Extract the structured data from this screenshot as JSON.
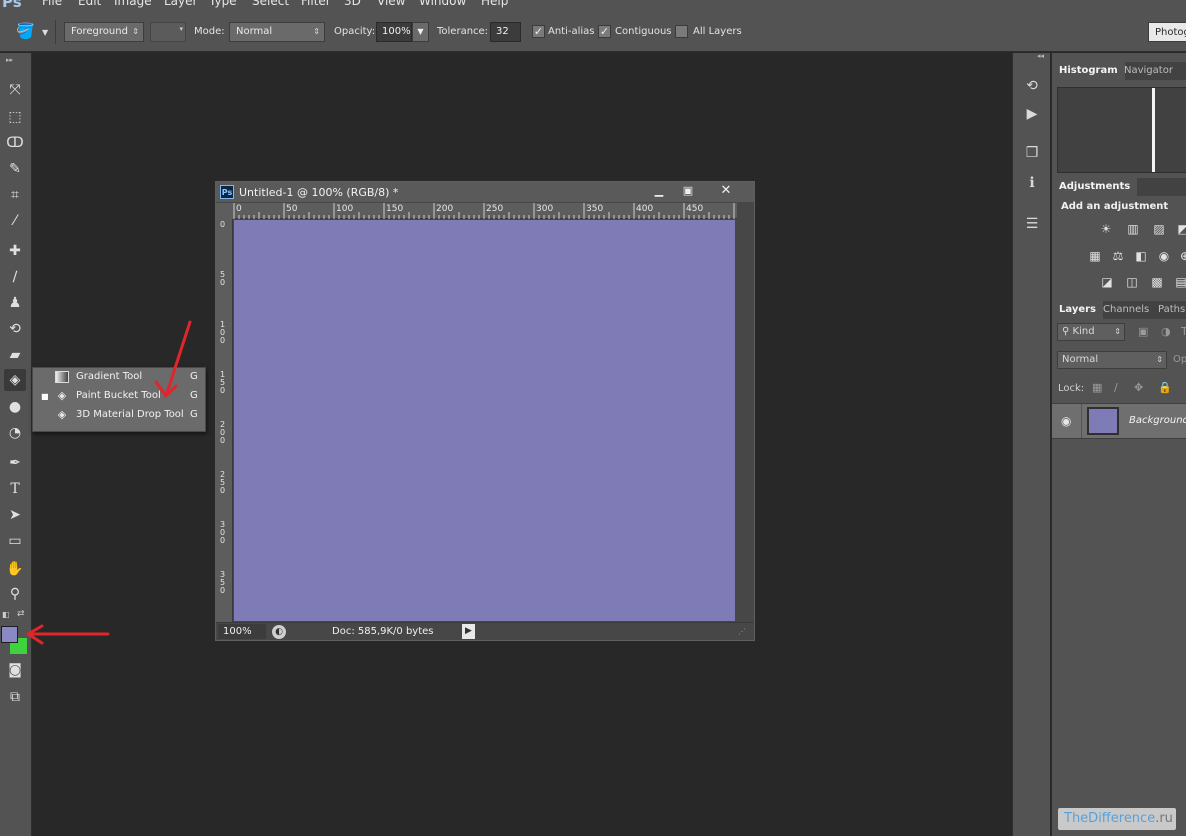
{
  "menubar": {
    "logo": "Ps",
    "items": [
      "File",
      "Edit",
      "Image",
      "Layer",
      "Type",
      "Select",
      "Filter",
      "3D",
      "View",
      "Window",
      "Help"
    ]
  },
  "options": {
    "fill_source": "Foreground",
    "mode_label": "Mode:",
    "mode_value": "Normal",
    "opacity_label": "Opacity:",
    "opacity_value": "100%",
    "tolerance_label": "Tolerance:",
    "tolerance_value": "32",
    "antialias_label": "Anti-alias",
    "antialias_checked": true,
    "contiguous_label": "Contiguous",
    "contiguous_checked": true,
    "alllayers_label": "All Layers",
    "alllayers_checked": false,
    "workspace_label": "Photog"
  },
  "flyout": {
    "items": [
      {
        "name": "Gradient Tool",
        "key": "G",
        "icon": "gradient-icon",
        "selected": false
      },
      {
        "name": "Paint Bucket Tool",
        "key": "G",
        "icon": "paint-bucket-icon",
        "selected": true
      },
      {
        "name": "3D Material Drop Tool",
        "key": "G",
        "icon": "3d-material-drop-icon",
        "selected": false
      }
    ]
  },
  "colors": {
    "foreground": "#8a89c6",
    "background": "#3fd13f",
    "canvas_fill": "#7f7bb6",
    "annotation_arrow": "#e0262a"
  },
  "document": {
    "badge": "Ps",
    "title": "Untitled-1 @ 100% (RGB/8) *",
    "ruler_h": [
      "0",
      "50",
      "100",
      "150",
      "200",
      "250",
      "300",
      "350",
      "400",
      "450"
    ],
    "ruler_v": [
      "0",
      "50",
      "100",
      "150",
      "200",
      "250",
      "300",
      "350"
    ],
    "zoom": "100%",
    "doc_info": "Doc: 585,9K/0 bytes"
  },
  "panels": {
    "histogram_tab": "Histogram",
    "navigator_tab": "Navigator",
    "adjustments_tab": "Adjustments",
    "add_adjustment": "Add an adjustment",
    "layers_tab": "Layers",
    "channels_tab": "Channels",
    "paths_tab": "Paths",
    "kind_filter": "Kind",
    "blend_mode": "Normal",
    "opacity_short": "Op",
    "lock_label": "Lock:",
    "layer_name": "Background"
  },
  "watermark": {
    "part1": "TheDifference",
    "part2": ".ru"
  }
}
